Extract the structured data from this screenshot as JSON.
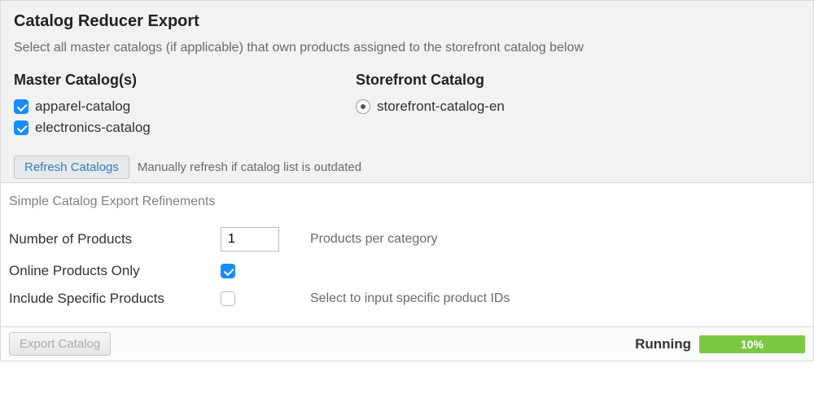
{
  "header": {
    "title": "Catalog Reducer Export",
    "subtitle": "Select all master catalogs (if applicable) that own products assigned to the storefront catalog below"
  },
  "master": {
    "heading": "Master Catalog(s)",
    "items": [
      {
        "label": "apparel-catalog",
        "checked": true
      },
      {
        "label": "electronics-catalog",
        "checked": true
      }
    ]
  },
  "storefront": {
    "heading": "Storefront Catalog",
    "items": [
      {
        "label": "storefront-catalog-en",
        "selected": true
      }
    ]
  },
  "refresh": {
    "button": "Refresh Catalogs",
    "help": "Manually refresh if catalog list is outdated"
  },
  "refinements": {
    "title": "Simple Catalog Export Refinements",
    "number_of_products": {
      "label": "Number of Products",
      "value": "1",
      "help": "Products per category"
    },
    "online_only": {
      "label": "Online Products Only",
      "checked": true
    },
    "include_specific": {
      "label": "Include Specific Products",
      "checked": false,
      "help": "Select to input specific product IDs"
    }
  },
  "footer": {
    "export_button": "Export Catalog",
    "export_disabled": true,
    "status": "Running",
    "progress_percent": 10,
    "progress_label": "10%"
  }
}
